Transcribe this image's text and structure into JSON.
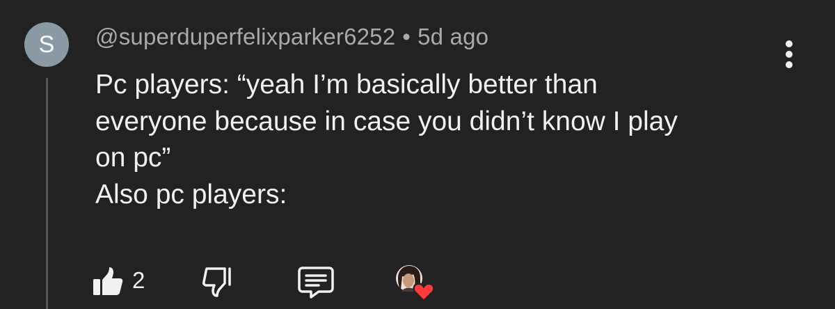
{
  "comment": {
    "avatar_initial": "S",
    "avatar_color": "#8a9aa4",
    "author": "@superduperfelixparker6252",
    "separator": "•",
    "timestamp": "5d ago",
    "text_lines": [
      "Pc players: “yeah I’m basically better than",
      "everyone because in case you didn’t know I play",
      "on pc”",
      "Also pc players:"
    ]
  },
  "actions": {
    "like_icon": "thumbs-up-icon",
    "like_count": "2",
    "dislike_icon": "thumbs-down-icon",
    "reply_icon": "comment-icon",
    "creator_heart_icon": "creator-heart-icon",
    "heart_color": "#ff3b3b"
  },
  "menu": {
    "icon": "more-vertical-icon"
  }
}
